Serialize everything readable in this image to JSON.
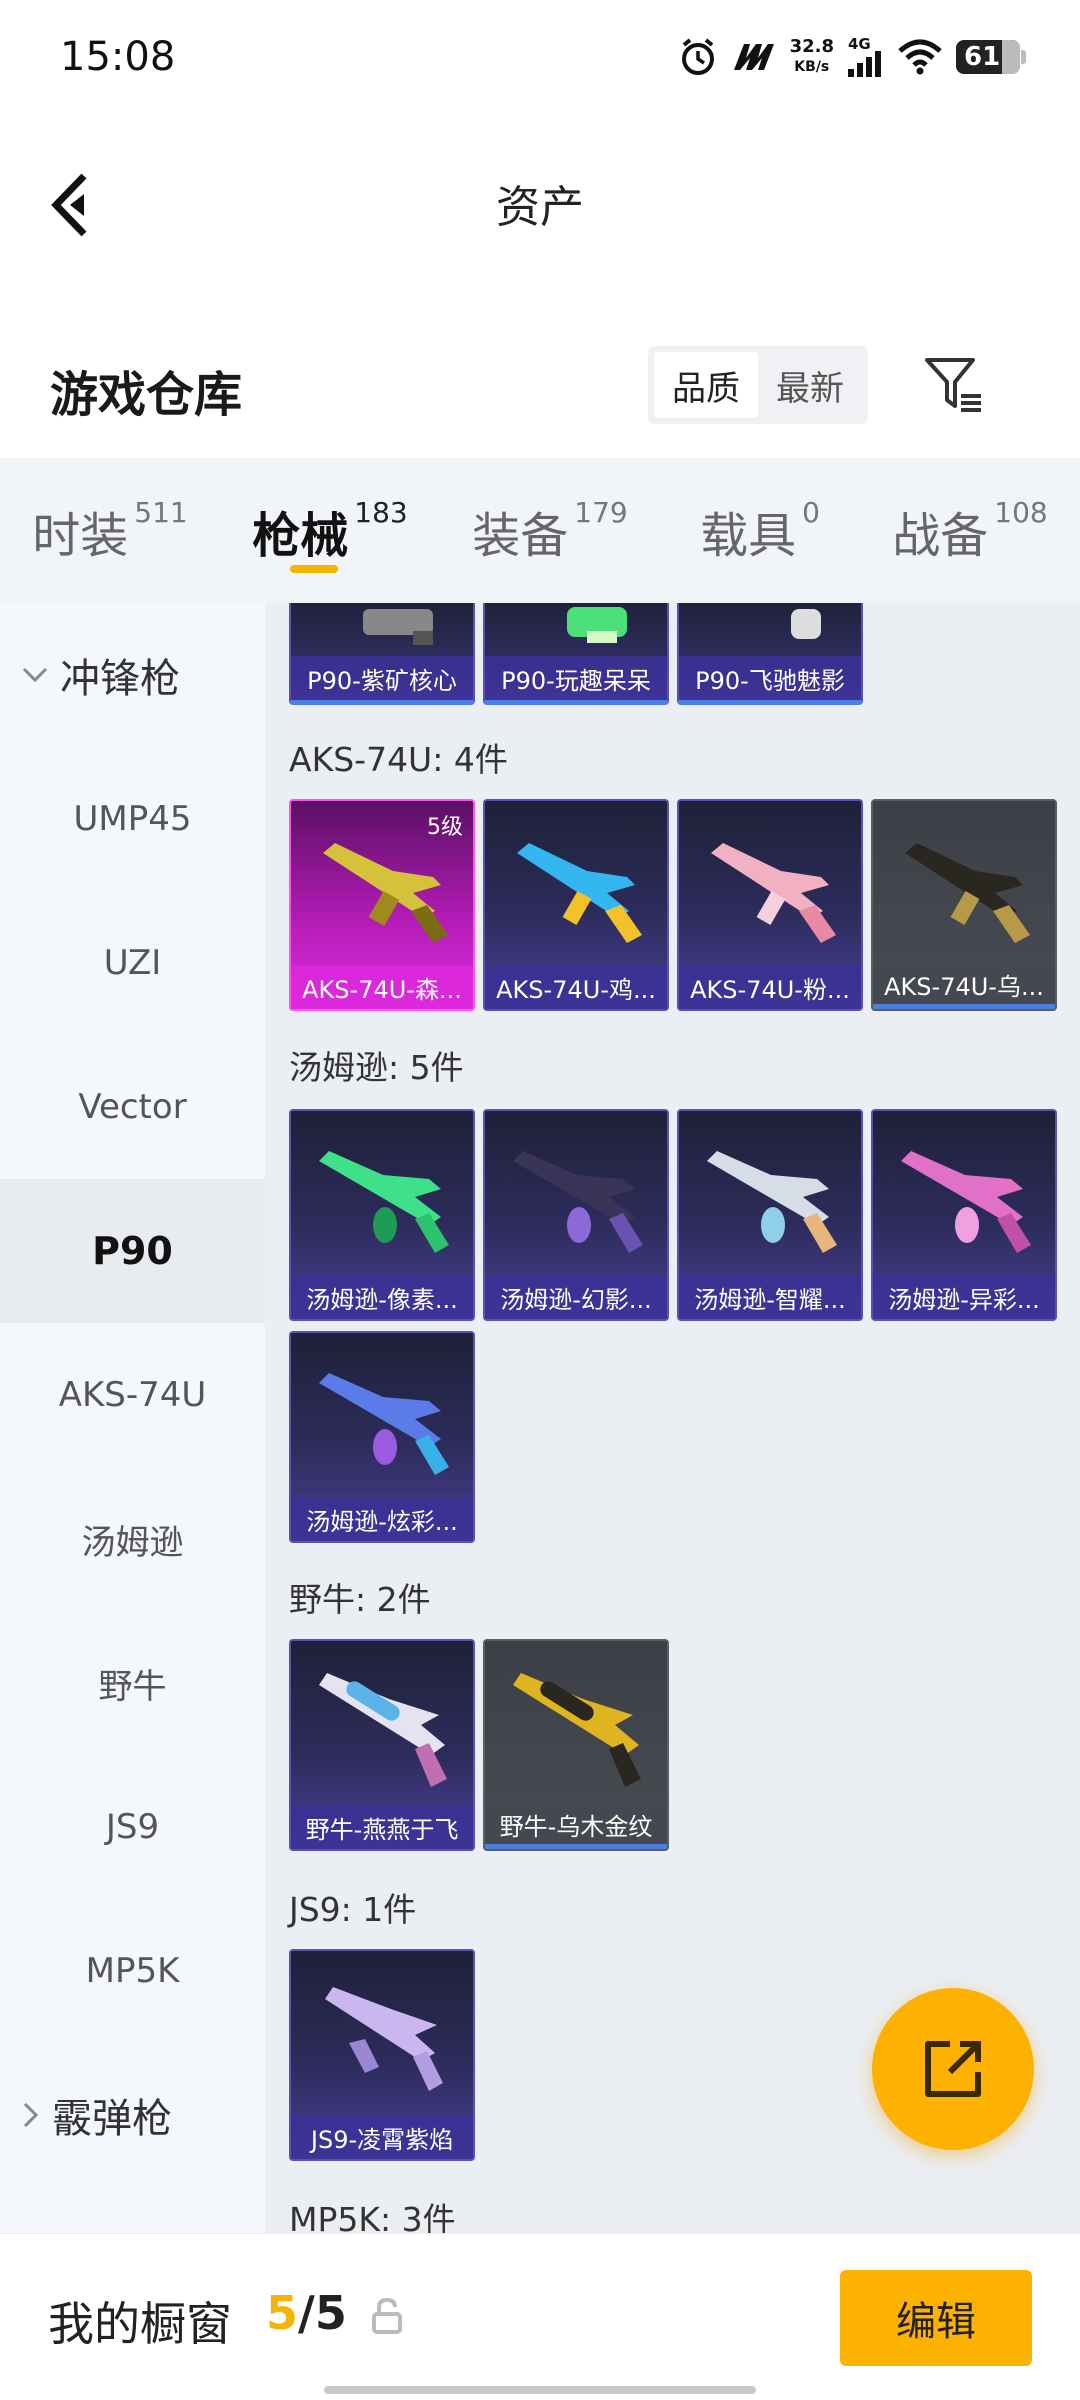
{
  "status_bar": {
    "time": "15:08",
    "net_speed_value": "32.8",
    "net_speed_unit": "KB/s",
    "network_type": "4G",
    "battery": "61",
    "icons": [
      "alarm-icon",
      "m-logo-icon",
      "signal-icon",
      "wifi-icon",
      "battery-icon"
    ]
  },
  "header": {
    "title": "资产",
    "back_icon": "chevron-left-icon"
  },
  "warehouse": {
    "title": "游戏仓库",
    "sort_options": [
      "品质",
      "最新"
    ],
    "sort_selected": "品质",
    "filter_icon": "filter-icon"
  },
  "tabs": [
    {
      "label": "时装",
      "count": "511"
    },
    {
      "label": "枪械",
      "count": "183",
      "active": true
    },
    {
      "label": "装备",
      "count": "179"
    },
    {
      "label": "载具",
      "count": "0"
    },
    {
      "label": "战备",
      "count": "108"
    }
  ],
  "sidenav": {
    "groups": [
      {
        "label": "冲锋枪",
        "expanded": true
      },
      {
        "label": "霰弹枪",
        "expanded": false
      }
    ],
    "items": [
      "UMP45",
      "UZI",
      "Vector",
      "P90",
      "AKS-74U",
      "汤姆逊",
      "野牛",
      "JS9",
      "MP5K"
    ],
    "active": "P90"
  },
  "content": {
    "p90_partial": [
      "P90-紫矿核心",
      "P90-玩趣呆呆",
      "P90-飞驰魅影"
    ],
    "groups": [
      {
        "title": "AKS-74U: 4件",
        "items": [
          {
            "name": "AKS-74U-森...",
            "level": "5级",
            "rarity": "gold"
          },
          {
            "name": "AKS-74U-鸡...",
            "rarity": "purple"
          },
          {
            "name": "AKS-74U-粉...",
            "rarity": "purple"
          },
          {
            "name": "AKS-74U-乌...",
            "rarity": "grey"
          }
        ]
      },
      {
        "title": "汤姆逊: 5件",
        "items": [
          {
            "name": "汤姆逊-像素...",
            "rarity": "purple"
          },
          {
            "name": "汤姆逊-幻影...",
            "rarity": "purple"
          },
          {
            "name": "汤姆逊-智耀...",
            "rarity": "purple"
          },
          {
            "name": "汤姆逊-异彩...",
            "rarity": "purple"
          },
          {
            "name": "汤姆逊-炫彩...",
            "rarity": "purple"
          }
        ]
      },
      {
        "title": "野牛: 2件",
        "items": [
          {
            "name": "野牛-燕燕于飞",
            "rarity": "purple"
          },
          {
            "name": "野牛-乌木金纹",
            "rarity": "grey"
          }
        ]
      },
      {
        "title": "JS9: 1件",
        "items": [
          {
            "name": "JS9-凌霄紫焰",
            "rarity": "purple"
          }
        ]
      },
      {
        "title": "MP5K: 3件",
        "items": []
      }
    ]
  },
  "fab": {
    "icon": "share-external-icon"
  },
  "bottom_bar": {
    "label": "我的橱窗",
    "current": "5",
    "separator": "/",
    "total": "5",
    "lock_icon": "lock-icon",
    "edit_label": "编辑"
  },
  "colors": {
    "accent": "#fdb100",
    "purple_card": "#4b3f97",
    "gold_card": "#e02ee0",
    "grey_card": "#4a4c54"
  }
}
